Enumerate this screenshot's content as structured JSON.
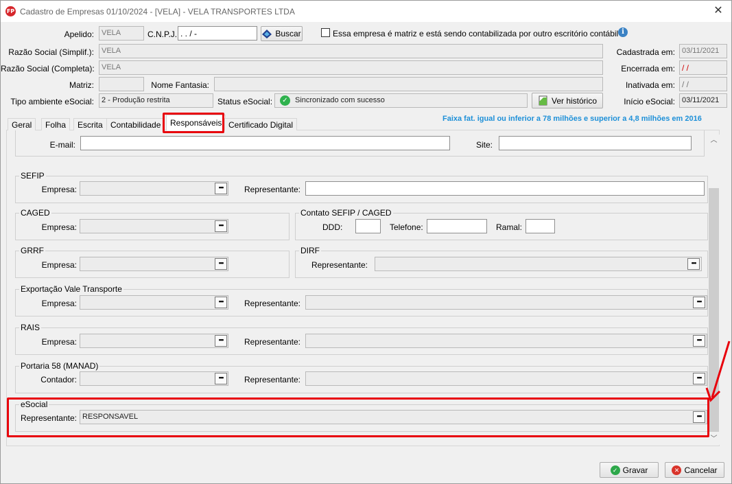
{
  "window": {
    "title": "Cadastro de Empresas  01/10/2024 - [VELA] - VELA TRANSPORTES LTDA",
    "app_badge": "FP"
  },
  "header": {
    "apelido_label": "Apelido:",
    "apelido_value": "VELA",
    "cnpj_label": "C.N.P.J.:",
    "cnpj_value": " .  .  /  -",
    "buscar_label": "Buscar",
    "matriz_checkbox_label": "Essa empresa é matriz e está sendo contabilizada por outro escritório contábil",
    "razao_simpl_label": "Razão Social (Simplif.):",
    "razao_simpl_value": "VELA",
    "razao_compl_label": "Razão Social (Completa):",
    "razao_compl_value": "VELA",
    "matriz_label": "Matriz:",
    "matriz_value": "",
    "nome_fantasia_label": "Nome Fantasia:",
    "nome_fantasia_value": "",
    "tipo_ambiente_label": "Tipo ambiente eSocial:",
    "tipo_ambiente_value": "2 - Produção restrita",
    "status_esocial_label": "Status eSocial:",
    "status_esocial_value": "Sincronizado com sucesso",
    "ver_historico_label": "Ver histórico",
    "cadastrada_label": "Cadastrada em:",
    "cadastrada_value": "03/11/2021",
    "encerrada_label": "Encerrada em:",
    "encerrada_value": " /  /",
    "inativada_label": "Inativada em:",
    "inativada_value": " /  /",
    "inicio_esocial_label": "Início eSocial:",
    "inicio_esocial_value": "03/11/2021"
  },
  "tabs": [
    {
      "label": "Geral"
    },
    {
      "label": "Folha"
    },
    {
      "label": "Escrita"
    },
    {
      "label": "Contabilidade"
    },
    {
      "label": "Responsáveis"
    },
    {
      "label": "Certificado Digital"
    }
  ],
  "faixa_text": "Faixa fat. igual ou inferior a 78 milhões e superior a 4,8 milhões em 2016",
  "panel": {
    "email_label": "E-mail:",
    "email_value": "",
    "site_label": "Site:",
    "site_value": "",
    "sefip": {
      "title": "SEFIP",
      "empresa_label": "Empresa:",
      "representante_label": "Representante:"
    },
    "caged": {
      "title": "CAGED",
      "empresa_label": "Empresa:"
    },
    "contato": {
      "title": "Contato SEFIP / CAGED",
      "ddd_label": "DDD:",
      "telefone_label": "Telefone:",
      "ramal_label": "Ramal:"
    },
    "grrf": {
      "title": "GRRF",
      "empresa_label": "Empresa:"
    },
    "dirf": {
      "title": "DIRF",
      "representante_label": "Representante:"
    },
    "vale": {
      "title": "Exportação Vale Transporte",
      "empresa_label": "Empresa:",
      "representante_label": "Representante:"
    },
    "rais": {
      "title": "RAIS",
      "empresa_label": "Empresa:",
      "representante_label": "Representante:"
    },
    "portaria": {
      "title": "Portaria 58 (MANAD)",
      "contador_label": "Contador:",
      "representante_label": "Representante:"
    },
    "esocial": {
      "title": "eSocial",
      "representante_label": "Representante:",
      "representante_value": "RESPONSAVEL"
    }
  },
  "footer": {
    "gravar_label": "Gravar",
    "cancelar_label": "Cancelar"
  },
  "colors": {
    "highlight": "#e8000b",
    "faixa": "#1e90d8",
    "status_ok": "#2fb24e"
  }
}
